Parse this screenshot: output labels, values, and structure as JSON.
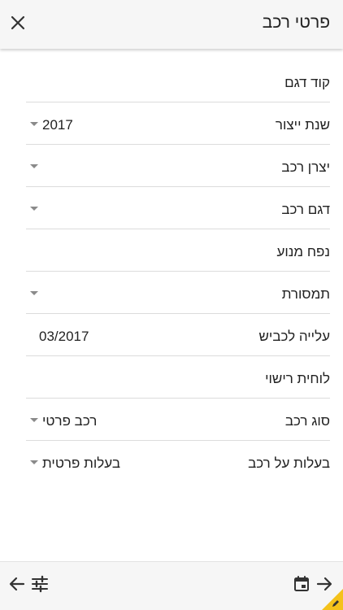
{
  "header": {
    "title": "פרטי רכב",
    "close_icon": "close-icon"
  },
  "form": {
    "rows": [
      {
        "label": "קוד דגם",
        "value": "",
        "dropdown": false
      },
      {
        "label": "שנת ייצור",
        "value": "2017",
        "dropdown": true
      },
      {
        "label": "יצרן רכב",
        "value": "",
        "dropdown": true
      },
      {
        "label": "דגם רכב",
        "value": "",
        "dropdown": true
      },
      {
        "label": "נפח מנוע",
        "value": "",
        "dropdown": false
      },
      {
        "label": "תמסורת",
        "value": "",
        "dropdown": true
      },
      {
        "label": "עלייה לכביש",
        "value": "03/2017",
        "dropdown": false
      },
      {
        "label": "לוחית רישוי",
        "value": "",
        "dropdown": false
      },
      {
        "label": "סוג רכב",
        "value": "רכב פרטי",
        "dropdown": true
      },
      {
        "label": "בעלות על רכב",
        "value": "בעלות פרטית",
        "dropdown": true
      }
    ]
  },
  "footer": {
    "icons": [
      "back-arrow-icon",
      "filter-sliders-icon",
      "calendar-icon",
      "forward-arrow-icon"
    ]
  },
  "colors": {
    "header_bg": "#f6f6f6",
    "divider": "#dcdcdc",
    "dropdown_arrow": "#8a8a8a",
    "corner_badge": "#f4c21b"
  }
}
